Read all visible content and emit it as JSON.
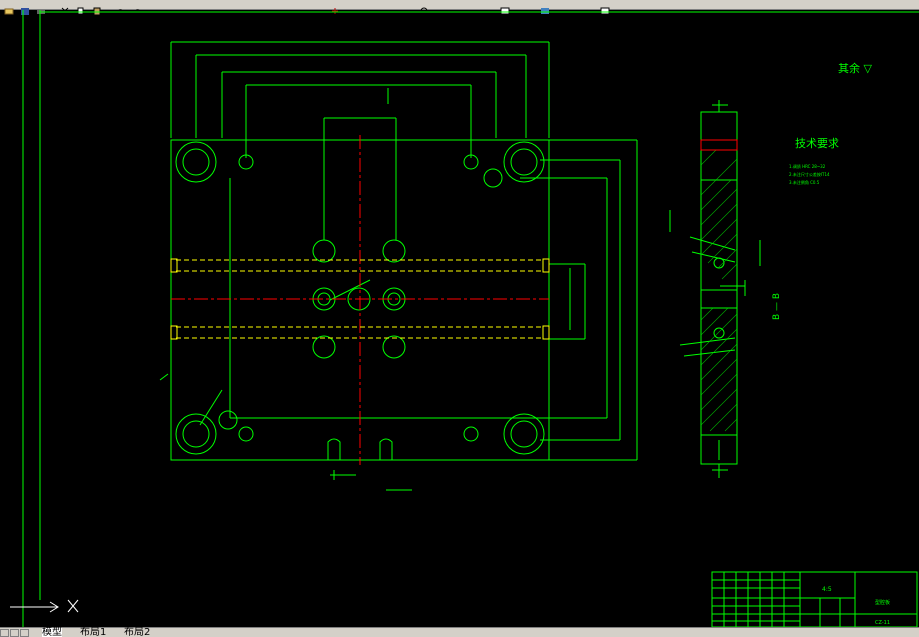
{
  "toolbar": {
    "icons": [
      "open-icon",
      "save-icon",
      "print-icon",
      "cut-icon",
      "copy-icon",
      "paste-icon",
      "undo-icon",
      "redo-icon",
      "pan-icon",
      "zoom-icon",
      "properties-icon",
      "layer-icon",
      "help-icon"
    ]
  },
  "drawing": {
    "stock_note": "其余 ▽",
    "tech_title": "技术要求",
    "tech_lines": [
      "1.调质 HRC 28~32",
      "2.未注尺寸公差按IT14",
      "3.未注倒角 C0.5"
    ],
    "section_label": "B — B",
    "title_scale": "4:5",
    "title_part": "型腔板",
    "title_code": "CZ-11"
  },
  "tabs": [
    {
      "label": "模型",
      "active": true
    },
    {
      "label": "布局1",
      "active": false
    },
    {
      "label": "布局2",
      "active": false
    }
  ],
  "colors": {
    "background": "#000000",
    "outline": "#00ff00",
    "centerline": "#ff0000",
    "water": "#ffff00",
    "ui": "#d4d0c8"
  }
}
